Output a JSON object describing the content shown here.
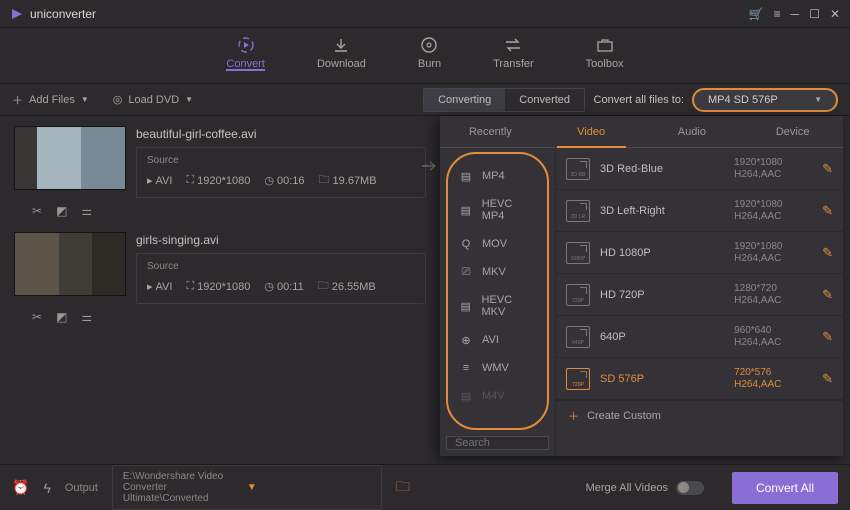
{
  "app": {
    "title": "uniconverter"
  },
  "nav": {
    "items": [
      {
        "label": "Convert"
      },
      {
        "label": "Download"
      },
      {
        "label": "Burn"
      },
      {
        "label": "Transfer"
      },
      {
        "label": "Toolbox"
      }
    ]
  },
  "toolbar": {
    "addFiles": "Add Files",
    "loadDvd": "Load DVD",
    "converting": "Converting",
    "converted": "Converted",
    "convertLabel": "Convert all files to:",
    "convertValue": "MP4 SD 576P"
  },
  "files": [
    {
      "name": "beautiful-girl-coffee.avi",
      "srcLabel": "Source",
      "fmt": "AVI",
      "res": "1920*1080",
      "dur": "00:16",
      "size": "19.67MB"
    },
    {
      "name": "girls-singing.avi",
      "srcLabel": "Source",
      "fmt": "AVI",
      "res": "1920*1080",
      "dur": "00:11",
      "size": "26.55MB"
    }
  ],
  "popup": {
    "tabs": [
      "Recently",
      "Video",
      "Audio",
      "Device"
    ],
    "formats": [
      "MP4",
      "HEVC MP4",
      "MOV",
      "MKV",
      "HEVC MKV",
      "AVI",
      "WMV",
      "M4V"
    ],
    "searchPlaceholder": "Search",
    "presets": [
      {
        "name": "3D Red-Blue",
        "res": "1920*1080",
        "codec": "H264,AAC",
        "tag": "3D RB"
      },
      {
        "name": "3D Left-Right",
        "res": "1920*1080",
        "codec": "H264,AAC",
        "tag": "3D LR"
      },
      {
        "name": "HD 1080P",
        "res": "1920*1080",
        "codec": "H264,AAC",
        "tag": "1080P"
      },
      {
        "name": "HD 720P",
        "res": "1280*720",
        "codec": "H264,AAC",
        "tag": "720P"
      },
      {
        "name": "640P",
        "res": "960*640",
        "codec": "H264,AAC",
        "tag": "640P"
      },
      {
        "name": "SD 576P",
        "res": "720*576",
        "codec": "H264,AAC",
        "tag": "720P"
      }
    ],
    "createCustom": "Create Custom"
  },
  "bottom": {
    "outputLabel": "Output",
    "outputPath": "E:\\Wondershare Video Converter Ultimate\\Converted",
    "merge": "Merge All Videos",
    "convert": "Convert All"
  }
}
